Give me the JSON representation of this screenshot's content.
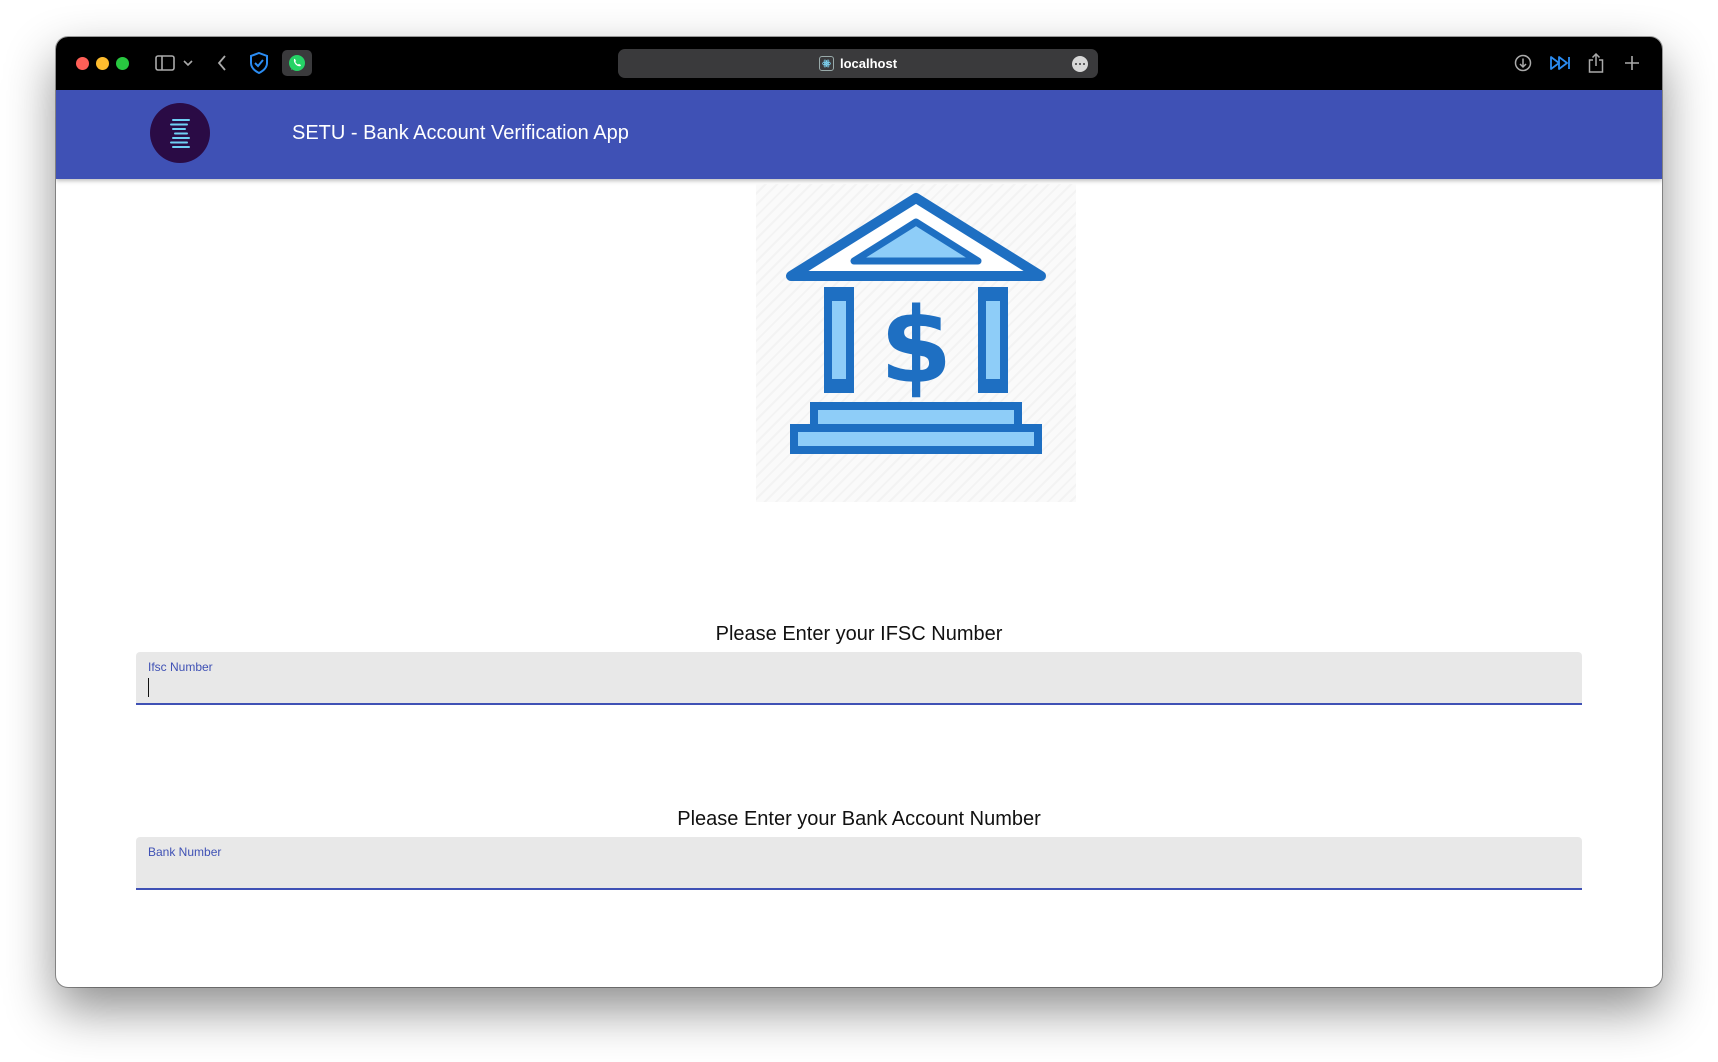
{
  "browser": {
    "url": "localhost",
    "icons": [
      "sidebar-icon",
      "chevron-down-icon",
      "back-icon",
      "shield-icon",
      "whatsapp-icon",
      "download-icon",
      "forward-icon",
      "share-icon",
      "new-tab-icon"
    ]
  },
  "app": {
    "title": "SETU - Bank Account Verification App",
    "brand_color": "#3f51b5"
  },
  "form": {
    "ifsc_prompt": "Please Enter your IFSC Number",
    "ifsc_label": "Ifsc Number",
    "ifsc_value": "",
    "bank_prompt": "Please Enter your Bank Account Number",
    "bank_label": "Bank Number",
    "bank_value": ""
  }
}
